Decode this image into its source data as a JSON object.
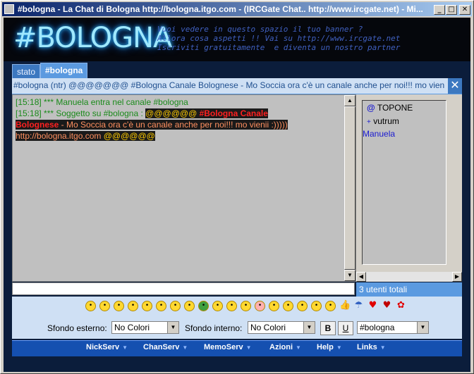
{
  "window": {
    "title": "#bologna - La Chat di Bologna http://bologna.itgo.com - (IRCGate Chat.. http://www.ircgate.net) - Mi...",
    "buttons": {
      "minimize": "_",
      "maximize": "□",
      "close": "✕"
    }
  },
  "banner": {
    "logo": "#BOLOGNA",
    "text": "Vuoi vedere in questo spazio il tuo banner ?\nAllora cosa aspetti !! Vai su http://www.ircgate.net\nIscriviti gratuitamente  e diventa un nostro partner"
  },
  "tabs": [
    {
      "label": "stato",
      "active": false
    },
    {
      "label": "#bologna",
      "active": true
    }
  ],
  "topic": "#bologna (ntr) @@@@@@@ #Bologna Canale Bolognese - Mo Soccia ora c'è un canale anche per noi!!! mo vienii :)))))",
  "chat": {
    "line1": "[15:18] *** Manuela entra nel canale #bologna",
    "line2_prefix": "[15:18] *** Soggetto su #bologna : ",
    "ats1": "@@@@@@",
    "title_part1": " #Bologna Canale",
    "title_part2": "Bolognese",
    "line3_rest": " - Mo Soccia ora c'è un canale anche per noi!!! mo vienii :)))))",
    "url": "http://bologna.itgo.com ",
    "ats2": "@@@@@@"
  },
  "users": [
    {
      "prefix": "@",
      "name": "TOPONE",
      "color": "#000000"
    },
    {
      "prefix": "+",
      "name": "vutrum",
      "color": "#000000"
    },
    {
      "prefix": "",
      "name": "Manuela",
      "color": "#1a1ad0"
    }
  ],
  "user_count": "3 utenti totali",
  "emoticons": [
    "smile-icon",
    "wink-icon",
    "cool-icon",
    "sad-icon",
    "eyes-icon",
    "devil-icon",
    "confused-icon",
    "grin-icon",
    "teeth-icon",
    "shout-icon",
    "blank-icon",
    "tongue-icon",
    "pig-icon",
    "dizzy-icon",
    "happy-icon",
    "surprised-icon",
    "evil-icon",
    "smirk-icon",
    "thumbsup-icon",
    "umbrella-icon",
    "heart-icon",
    "broken-heart-icon",
    "flower-icon"
  ],
  "settings": {
    "external_label": "Sfondo esterno:",
    "external_value": "No Colori",
    "internal_label": "Sfondo interno:",
    "internal_value": "No Colori",
    "bold": "B",
    "underline": "U",
    "channel_value": "#bologna"
  },
  "menu": [
    "NickServ",
    "ChanServ",
    "MemoServ",
    "Azioni",
    "Help",
    "Links"
  ],
  "colors": {
    "accent": "#5b9ae0",
    "menu_bg": "#1550b0",
    "chat_bg": "#c0c0c0",
    "highlight_red": "#ff2020"
  }
}
